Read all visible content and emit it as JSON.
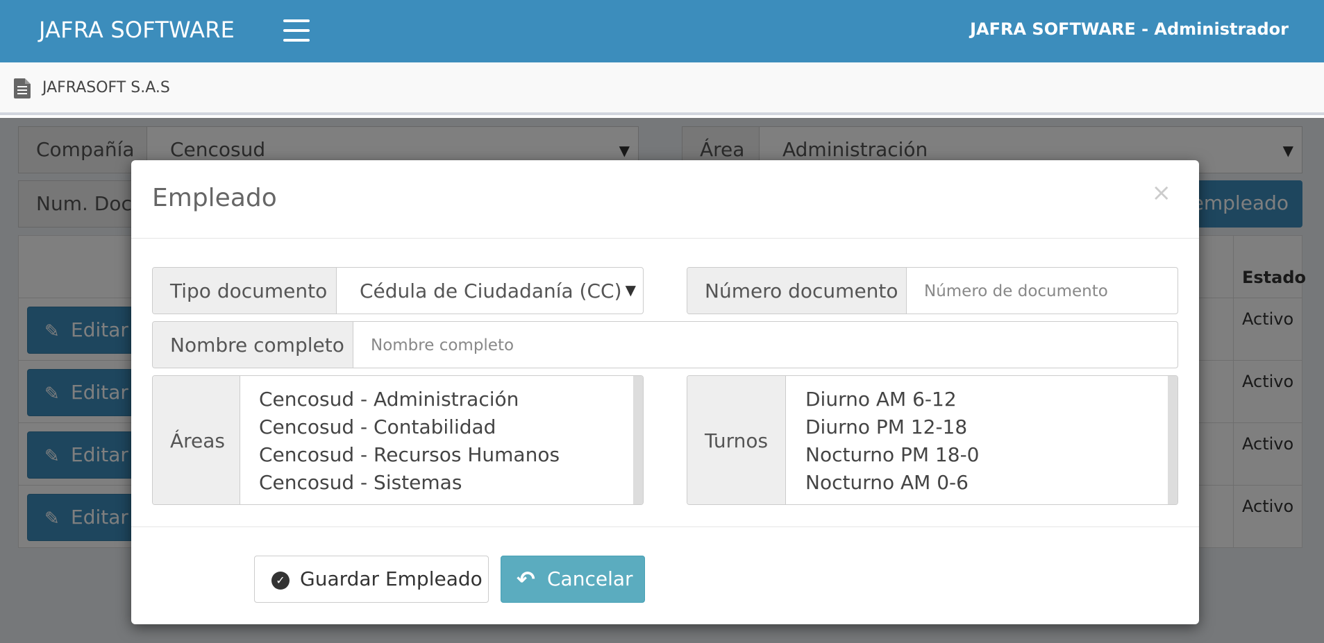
{
  "navbar": {
    "brand": "JAFRA SOFTWARE",
    "user_info": "JAFRA SOFTWARE  -  Administrador"
  },
  "subbar": {
    "company": "JAFRASOFT S.A.S",
    "icon": "document-icon"
  },
  "background": {
    "company_label": "Compañía",
    "company_value": "Cencosud",
    "area_label": "Área",
    "area_value": "Administración",
    "doc_label": "Num. Docu",
    "add_button_partial": "empleado",
    "table": {
      "estado_header": "Estado",
      "rows": [
        {
          "edit_label": "Editar",
          "estado": "Activo"
        },
        {
          "edit_label": "Editar",
          "estado": "Activo"
        },
        {
          "edit_label": "Editar",
          "estado": "Activo"
        },
        {
          "edit_label": "Editar",
          "estado": "Activo"
        }
      ]
    }
  },
  "modal": {
    "title": "Empleado",
    "close": "×",
    "tipo_documento": {
      "label": "Tipo documento",
      "value": "Cédula de Ciudadanía (CC)"
    },
    "numero_documento": {
      "label": "Número documento",
      "placeholder": "Número de documento"
    },
    "nombre_completo": {
      "label": "Nombre completo",
      "placeholder": "Nombre completo"
    },
    "areas": {
      "label": "Áreas",
      "options": [
        "Cencosud - Administración",
        "Cencosud - Contabilidad",
        "Cencosud - Recursos Humanos",
        "Cencosud - Sistemas"
      ]
    },
    "turnos": {
      "label": "Turnos",
      "options": [
        "Diurno AM 6-12",
        "Diurno PM 12-18",
        "Nocturno PM 18-0",
        "Nocturno AM 0-6"
      ]
    },
    "save_label": "Guardar Empleado",
    "cancel_label": "Cancelar"
  },
  "colors": {
    "navbar": "#3c8dbc",
    "cancel_button": "#5bacbf"
  }
}
